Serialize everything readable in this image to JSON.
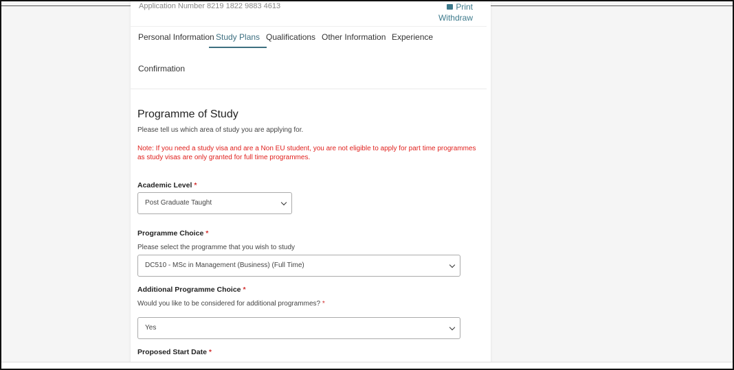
{
  "header": {
    "application_number": "Application Number 8219 1822 9883 4613",
    "print_label": "Print",
    "withdraw_label": "Withdraw"
  },
  "tabs": [
    {
      "label": "Personal Information"
    },
    {
      "label": "Study Plans",
      "active": true
    },
    {
      "label": "Qualifications"
    },
    {
      "label": "Other Information"
    },
    {
      "label": "Experience"
    },
    {
      "label": "Confirmation"
    }
  ],
  "section": {
    "title": "Programme of Study",
    "subtitle": "Please tell us which area of study you are applying for.",
    "note": "Note: If you need a study visa and are a Non EU student, you are not eligible to apply for part time programmes as study visas are only granted for full time programmes."
  },
  "fields": {
    "academic_level": {
      "label": "Academic Level",
      "required": "*",
      "value": "Post Graduate Taught"
    },
    "programme_choice": {
      "label": "Programme Choice",
      "required": "*",
      "help": "Please select the programme that you wish to study",
      "value": "DC510 - MSc in Management (Business) (Full Time)"
    },
    "additional_choice": {
      "label": "Additional Programme Choice",
      "required": "*",
      "help": "Would you like to be considered for additional programmes?",
      "help_required": "*",
      "value": "Yes"
    },
    "start_date": {
      "label": "Proposed Start Date",
      "required": "*"
    }
  },
  "colors": {
    "accent": "#3d6f80",
    "note_red": "#e0201d",
    "required_red": "#d32f2f"
  }
}
